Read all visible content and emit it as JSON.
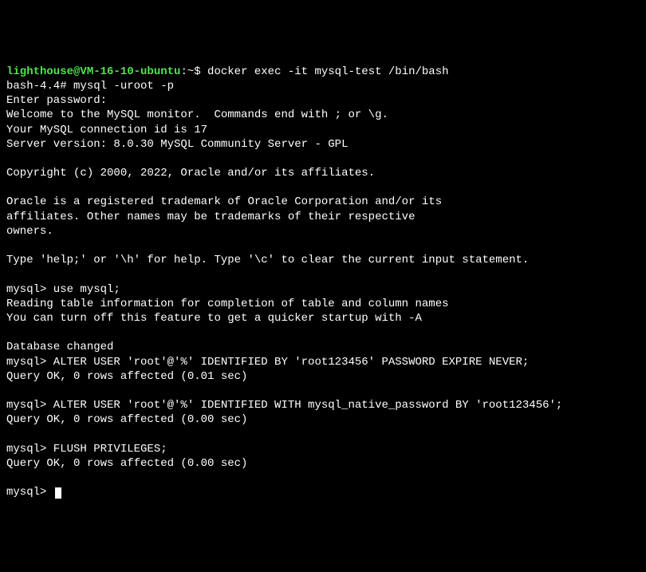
{
  "prompt": {
    "user_host": "lighthouse@VM-16-10-ubuntu",
    "separator": ":",
    "path": "~",
    "dollar": "$",
    "command": " docker exec -it mysql-test /bin/bash"
  },
  "bash_prompt": "bash-4.4# mysql -uroot -p",
  "enter_password": "Enter password:",
  "welcome": "Welcome to the MySQL monitor.  Commands end with ; or \\g.",
  "connection_id": "Your MySQL connection id is 17",
  "server_version": "Server version: 8.0.30 MySQL Community Server - GPL",
  "copyright": "Copyright (c) 2000, 2022, Oracle and/or its affiliates.",
  "trademark1": "Oracle is a registered trademark of Oracle Corporation and/or its",
  "trademark2": "affiliates. Other names may be trademarks of their respective",
  "trademark3": "owners.",
  "help_line": "Type 'help;' or '\\h' for help. Type '\\c' to clear the current input statement.",
  "mysql_use": "mysql> use mysql;",
  "reading_table": "Reading table information for completion of table and column names",
  "turn_off": "You can turn off this feature to get a quicker startup with -A",
  "db_changed": "Database changed",
  "alter1": "mysql> ALTER USER 'root'@'%' IDENTIFIED BY 'root123456' PASSWORD EXPIRE NEVER;",
  "query_ok1": "Query OK, 0 rows affected (0.01 sec)",
  "alter2": "mysql> ALTER USER 'root'@'%' IDENTIFIED WITH mysql_native_password BY 'root123456';",
  "query_ok2": "Query OK, 0 rows affected (0.00 sec)",
  "flush": "mysql> FLUSH PRIVILEGES;",
  "query_ok3": "Query OK, 0 rows affected (0.00 sec)",
  "final_prompt": "mysql> "
}
